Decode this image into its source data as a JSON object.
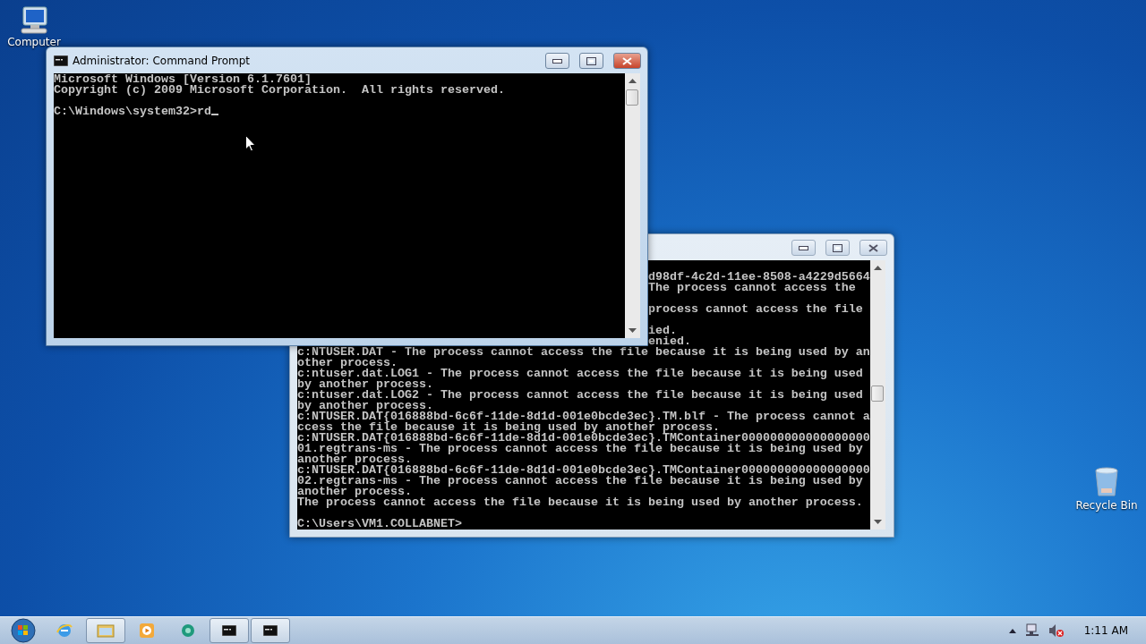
{
  "desktop_icons": [
    {
      "kind": "computer",
      "label": "Computer"
    },
    {
      "kind": "recycle",
      "label": "Recycle Bin"
    }
  ],
  "windows": [
    {
      "active": false,
      "lines": [
        {
          "kind": "blank"
        },
        {
          "kind": "partial",
          "text": "d98df-4c2d-11ee-8508-a4229d5664"
        },
        {
          "kind": "partial",
          "text": "The process cannot access the"
        },
        {
          "kind": "blank"
        },
        {
          "kind": "partial",
          "text": "process cannot access the file"
        },
        {
          "kind": "blank"
        },
        {
          "kind": "partial",
          "text": "ied."
        },
        {
          "kind": "partial",
          "text": "enied."
        },
        {
          "kind": "full",
          "text": "c:NTUSER.DAT - The process cannot access the file because it is being used by an"
        },
        {
          "kind": "full",
          "text": "other process."
        },
        {
          "kind": "full",
          "text": "c:ntuser.dat.LOG1 - The process cannot access the file because it is being used"
        },
        {
          "kind": "full",
          "text": "by another process."
        },
        {
          "kind": "full",
          "text": "c:ntuser.dat.LOG2 - The process cannot access the file because it is being used"
        },
        {
          "kind": "full",
          "text": "by another process."
        },
        {
          "kind": "full",
          "text": "c:NTUSER.DAT{016888bd-6c6f-11de-8d1d-001e0bcde3ec}.TM.blf - The process cannot a"
        },
        {
          "kind": "full",
          "text": "ccess the file because it is being used by another process."
        },
        {
          "kind": "full",
          "text": "c:NTUSER.DAT{016888bd-6c6f-11de-8d1d-001e0bcde3ec}.TMContainer000000000000000000"
        },
        {
          "kind": "full",
          "text": "01.regtrans-ms - The process cannot access the file because it is being used by"
        },
        {
          "kind": "full",
          "text": "another process."
        },
        {
          "kind": "full",
          "text": "c:NTUSER.DAT{016888bd-6c6f-11de-8d1d-001e0bcde3ec}.TMContainer000000000000000000"
        },
        {
          "kind": "full",
          "text": "02.regtrans-ms - The process cannot access the file because it is being used by"
        },
        {
          "kind": "full",
          "text": "another process."
        },
        {
          "kind": "full",
          "text": "The process cannot access the file because it is being used by another process."
        },
        {
          "kind": "blank"
        },
        {
          "kind": "full",
          "text": "C:\\Users\\VM1.COLLABNET>"
        }
      ]
    },
    {
      "active": true,
      "title": "Administrator:  Command Prompt",
      "lines": [
        {
          "kind": "full",
          "text": "Microsoft Windows [Version 6.1.7601]"
        },
        {
          "kind": "full",
          "text": "Copyright (c) 2009 Microsoft Corporation.  All rights reserved."
        },
        {
          "kind": "blank"
        },
        {
          "kind": "prompt",
          "text": "C:\\Windows\\system32>rd"
        }
      ]
    }
  ],
  "taskbar": {
    "buttons": [
      {
        "kind": "ie",
        "running": false
      },
      {
        "kind": "explorer",
        "running": true
      },
      {
        "kind": "media",
        "running": false
      },
      {
        "kind": "green",
        "running": false
      },
      {
        "kind": "cmd",
        "running": true
      },
      {
        "kind": "cmd",
        "running": true
      }
    ],
    "clock": "1:11 AM"
  }
}
